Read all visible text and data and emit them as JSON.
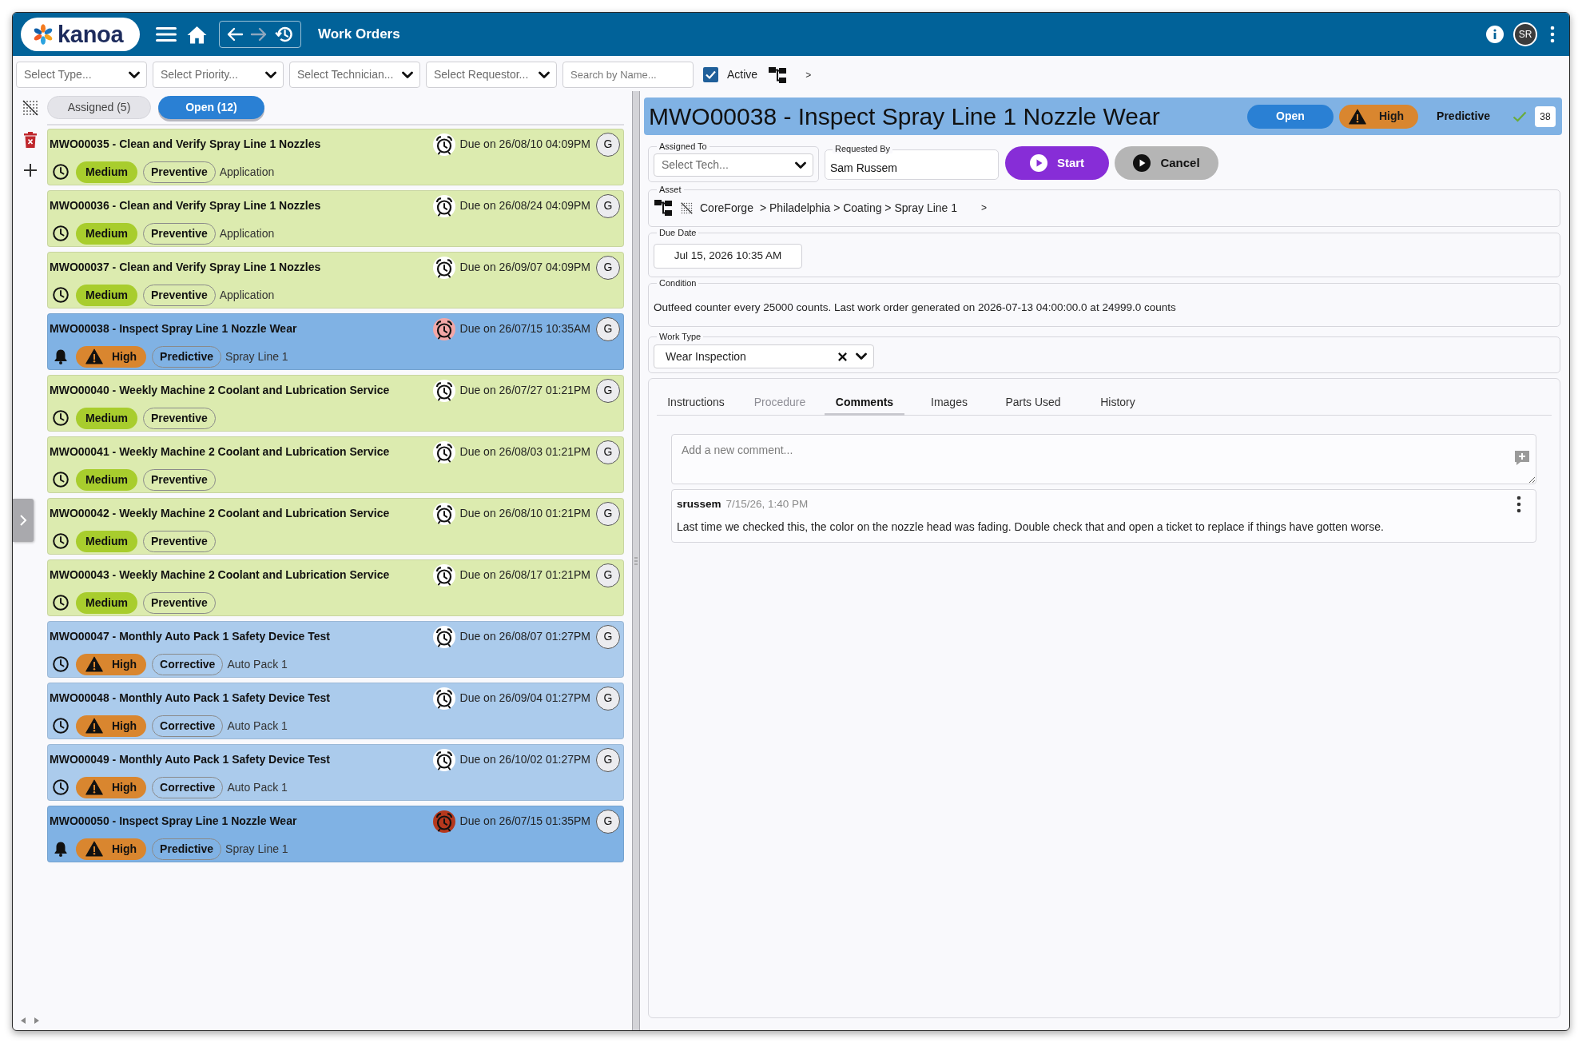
{
  "app_bar": {
    "logo": "kanoa",
    "nav_buttons": [
      {
        "kind": "back",
        "disabled": false
      },
      {
        "kind": "forward",
        "disabled": true
      },
      {
        "kind": "history",
        "disabled": false
      }
    ],
    "title": "Work Orders",
    "user_initials": "SR"
  },
  "filters": {
    "selects": [
      {
        "placeholder": "Select Type..."
      },
      {
        "placeholder": "Select Priority..."
      },
      {
        "placeholder": "Select Technician..."
      },
      {
        "placeholder": "Select Requestor..."
      }
    ],
    "search": {
      "placeholder": "Search by Name..."
    },
    "active": {
      "label": "Active",
      "checked": true
    },
    "toggle": ">"
  },
  "list_tabs": [
    {
      "label": "Assigned (5)",
      "selected": false
    },
    {
      "label": "Open (12)",
      "selected": true
    }
  ],
  "work_orders": [
    {
      "title": "MWO00035 - Clean and Verify Spray Line 1 Nozzles",
      "color": "#dcebaf",
      "kind": "clock",
      "due": {
        "text": "Due on 26/08/10 04:09PM",
        "color": "#ffffff"
      },
      "assignee": "G",
      "priority": {
        "label": "Medium",
        "kind": "medium"
      },
      "type": "Preventive",
      "asset": "Application"
    },
    {
      "title": "MWO00036 - Clean and Verify Spray Line 1 Nozzles",
      "color": "#dcebaf",
      "kind": "clock",
      "due": {
        "text": "Due on 26/08/24 04:09PM",
        "color": "#ffffff"
      },
      "assignee": "G",
      "priority": {
        "label": "Medium",
        "kind": "medium"
      },
      "type": "Preventive",
      "asset": "Application"
    },
    {
      "title": "MWO00037 - Clean and Verify Spray Line 1 Nozzles",
      "color": "#dcebaf",
      "kind": "clock",
      "due": {
        "text": "Due on 26/09/07 04:09PM",
        "color": "#ffffff"
      },
      "assignee": "G",
      "priority": {
        "label": "Medium",
        "kind": "medium"
      },
      "type": "Preventive",
      "asset": "Application"
    },
    {
      "title": "MWO00038 - Inspect Spray Line 1 Nozzle Wear",
      "color": "#80b2e4",
      "kind": "bell",
      "due": {
        "text": "Due on 26/07/15 10:35AM",
        "color": "#f2a7a7"
      },
      "assignee": "G",
      "priority": {
        "label": "High",
        "kind": "high"
      },
      "type": "Predictive",
      "asset": "Spray Line 1"
    },
    {
      "title": "MWO00040 - Weekly Machine 2 Coolant and Lubrication Service",
      "color": "#dcebaf",
      "kind": "clock",
      "due": {
        "text": "Due on 26/07/27 01:21PM",
        "color": "#ffffff"
      },
      "assignee": "G",
      "priority": {
        "label": "Medium",
        "kind": "medium"
      },
      "type": "Preventive"
    },
    {
      "title": "MWO00041 - Weekly Machine 2 Coolant and Lubrication Service",
      "color": "#dcebaf",
      "kind": "clock",
      "due": {
        "text": "Due on 26/08/03 01:21PM",
        "color": "#ffffff"
      },
      "assignee": "G",
      "priority": {
        "label": "Medium",
        "kind": "medium"
      },
      "type": "Preventive"
    },
    {
      "title": "MWO00042 - Weekly Machine 2 Coolant and Lubrication Service",
      "color": "#dcebaf",
      "kind": "clock",
      "due": {
        "text": "Due on 26/08/10 01:21PM",
        "color": "#ffffff"
      },
      "assignee": "G",
      "priority": {
        "label": "Medium",
        "kind": "medium"
      },
      "type": "Preventive"
    },
    {
      "title": "MWO00043 - Weekly Machine 2 Coolant and Lubrication Service",
      "color": "#dcebaf",
      "kind": "clock",
      "due": {
        "text": "Due on 26/08/17 01:21PM",
        "color": "#ffffff"
      },
      "assignee": "G",
      "priority": {
        "label": "Medium",
        "kind": "medium"
      },
      "type": "Preventive"
    },
    {
      "title": "MWO00047 - Monthly Auto Pack 1 Safety Device Test",
      "color": "#abcbec",
      "kind": "clock",
      "due": {
        "text": "Due on 26/08/07 01:27PM",
        "color": "#ffffff"
      },
      "assignee": "G",
      "priority": {
        "label": "High",
        "kind": "high"
      },
      "type": "Corrective",
      "asset": "Auto Pack 1"
    },
    {
      "title": "MWO00048 - Monthly Auto Pack 1 Safety Device Test",
      "color": "#abcbec",
      "kind": "clock",
      "due": {
        "text": "Due on 26/09/04 01:27PM",
        "color": "#ffffff"
      },
      "assignee": "G",
      "priority": {
        "label": "High",
        "kind": "high"
      },
      "type": "Corrective",
      "asset": "Auto Pack 1"
    },
    {
      "title": "MWO00049 - Monthly Auto Pack 1 Safety Device Test",
      "color": "#abcbec",
      "kind": "clock",
      "due": {
        "text": "Due on 26/10/02 01:27PM",
        "color": "#ffffff"
      },
      "assignee": "G",
      "priority": {
        "label": "High",
        "kind": "high"
      },
      "type": "Corrective",
      "asset": "Auto Pack 1"
    },
    {
      "title": "MWO00050 - Inspect Spray Line 1 Nozzle Wear",
      "color": "#80b2e4",
      "kind": "bell",
      "due": {
        "text": "Due on 26/07/15 01:35PM",
        "color": "#b5381d"
      },
      "assignee": "G",
      "priority": {
        "label": "High",
        "kind": "high"
      },
      "type": "Predictive",
      "asset": "Spray Line 1"
    }
  ],
  "detail": {
    "title": "MWO00038 - Inspect Spray Line 1 Nozzle Wear",
    "status": "Open",
    "priority": {
      "label": "High",
      "kind": "high"
    },
    "type": "Predictive",
    "verified": true,
    "count": "38",
    "assigned_to": {
      "label": "Assigned To",
      "placeholder": "Select Tech..."
    },
    "requested_by": {
      "label": "Requested By",
      "value": "Sam Russem"
    },
    "actions": [
      {
        "label": "Start",
        "kind": "start"
      },
      {
        "label": "Cancel",
        "kind": "cancel"
      }
    ],
    "asset": {
      "label": "Asset",
      "root": "CoreForge",
      "path": "> Philadelphia > Coating > Spray Line 1",
      "more": ">"
    },
    "due_date": {
      "label": "Due Date",
      "value": "Jul 15, 2026 10:35 AM"
    },
    "condition": {
      "label": "Condition",
      "text": "Outfeed counter every 25000 counts. Last work order generated on 2026-07-13 04:00:00.0 at 24999.0 counts"
    },
    "work_type": {
      "label": "Work Type",
      "value": "Wear Inspection"
    },
    "tabs": [
      {
        "label": "Instructions",
        "selected": false,
        "disabled": false
      },
      {
        "label": "Procedure",
        "selected": false,
        "disabled": true
      },
      {
        "label": "Comments",
        "selected": true,
        "disabled": false
      },
      {
        "label": "Images",
        "selected": false,
        "disabled": false
      },
      {
        "label": "Parts Used",
        "selected": false,
        "disabled": false
      },
      {
        "label": "History",
        "selected": false,
        "disabled": false
      }
    ],
    "comment_box": {
      "placeholder": "Add a new comment..."
    },
    "comments": [
      {
        "author": "srussem",
        "time": "7/15/26, 1:40 PM",
        "text": "Last time we checked this, the color on the nozzle head was fading. Double check that and open a ticket to replace if things have gotten worse."
      }
    ]
  }
}
